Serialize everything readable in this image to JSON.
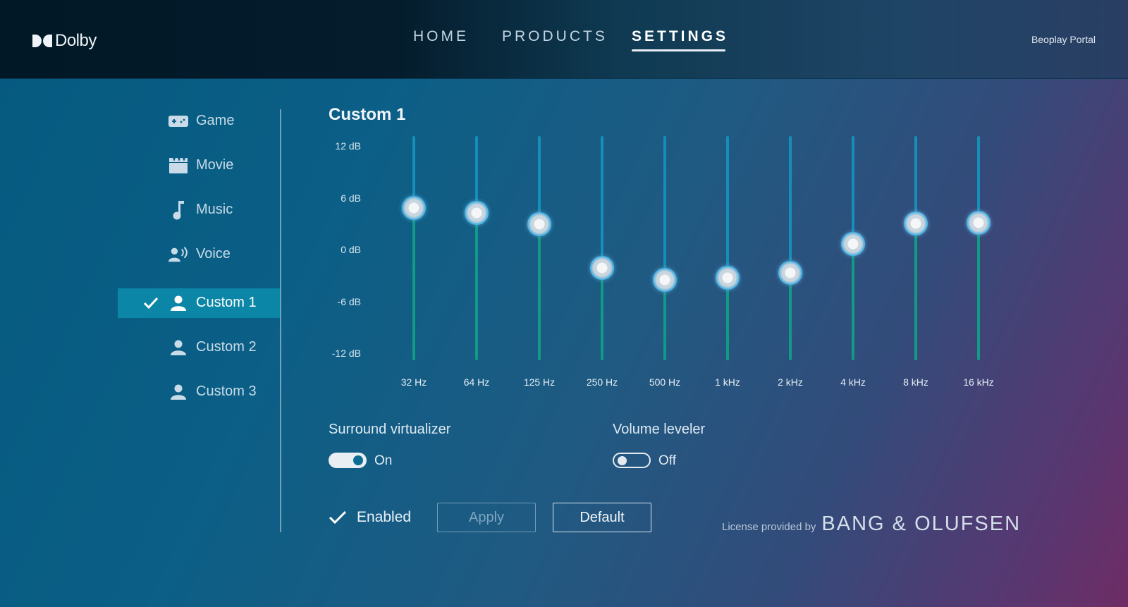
{
  "header": {
    "logo_text": "Dolby",
    "nav": [
      {
        "label": "HOME",
        "active": false
      },
      {
        "label": "PRODUCTS",
        "active": false
      },
      {
        "label": "SETTINGS",
        "active": true
      }
    ],
    "portal_link": "Beoplay Portal"
  },
  "sidebar": {
    "items": [
      {
        "label": "Game",
        "icon": "gamepad-icon",
        "active": false
      },
      {
        "label": "Movie",
        "icon": "clapperboard-icon",
        "active": false
      },
      {
        "label": "Music",
        "icon": "music-note-icon",
        "active": false
      },
      {
        "label": "Voice",
        "icon": "voice-icon",
        "active": false
      },
      {
        "label": "Custom 1",
        "icon": "user-icon",
        "active": true
      },
      {
        "label": "Custom 2",
        "icon": "user-icon",
        "active": false
      },
      {
        "label": "Custom 3",
        "icon": "user-icon",
        "active": false
      }
    ]
  },
  "equalizer": {
    "title": "Custom 1",
    "db_labels": [
      "12 dB",
      "6 dB",
      "0 dB",
      "-6 dB",
      "-12 dB"
    ],
    "range_db": [
      -12,
      12
    ],
    "bands": [
      {
        "freq": "32 Hz",
        "gain_db": 4.7
      },
      {
        "freq": "64 Hz",
        "gain_db": 4.1
      },
      {
        "freq": "125 Hz",
        "gain_db": 2.8
      },
      {
        "freq": "250 Hz",
        "gain_db": -2.3
      },
      {
        "freq": "500 Hz",
        "gain_db": -3.7
      },
      {
        "freq": "1 kHz",
        "gain_db": -3.5
      },
      {
        "freq": "2 kHz",
        "gain_db": -2.9
      },
      {
        "freq": "4 kHz",
        "gain_db": 0.5
      },
      {
        "freq": "8 kHz",
        "gain_db": 2.9
      },
      {
        "freq": "16 kHz",
        "gain_db": 3.0
      }
    ]
  },
  "options": {
    "surround": {
      "label": "Surround virtualizer",
      "state": "On",
      "on": true
    },
    "leveler": {
      "label": "Volume leveler",
      "state": "Off",
      "on": false
    }
  },
  "footer": {
    "enabled_label": "Enabled",
    "apply_label": "Apply",
    "default_label": "Default",
    "license_text": "License provided by",
    "license_brand": "BANG & OLUFSEN"
  },
  "colors": {
    "accent_active": "#0b86a6",
    "track_upper": "#168fb8",
    "track_lower": "#119a86"
  }
}
